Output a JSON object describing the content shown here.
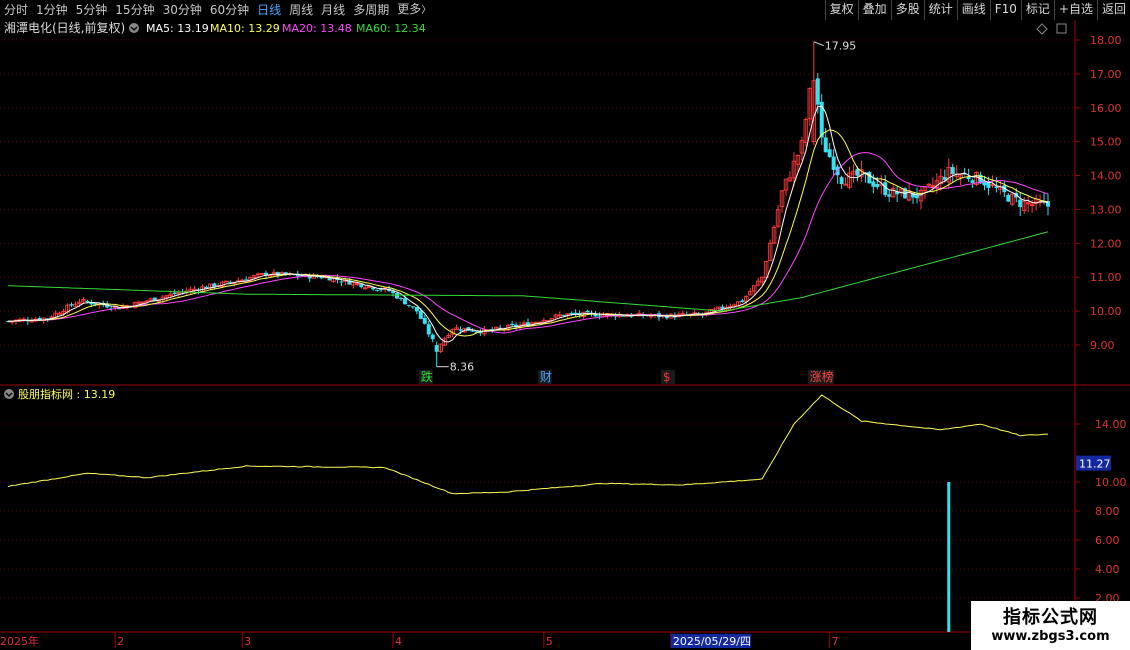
{
  "toolbar": {
    "left": [
      {
        "label": "分时",
        "active": false
      },
      {
        "label": "1分钟",
        "active": false
      },
      {
        "label": "5分钟",
        "active": false
      },
      {
        "label": "15分钟",
        "active": false
      },
      {
        "label": "30分钟",
        "active": false
      },
      {
        "label": "60分钟",
        "active": false
      },
      {
        "label": "日线",
        "active": true
      },
      {
        "label": "周线",
        "active": false
      },
      {
        "label": "月线",
        "active": false
      },
      {
        "label": "多周期",
        "active": false
      },
      {
        "label": "更多",
        "active": false
      }
    ],
    "more_arrow": "〉",
    "right": [
      "复权",
      "叠加",
      "多股",
      "统计",
      "画线",
      "F10",
      "标记",
      "+自选",
      "返回"
    ]
  },
  "main_panel": {
    "stock_title": "湘潭电化(日线,前复权)",
    "ma": [
      {
        "label": "MA5: 13.19",
        "color": "#ffffff"
      },
      {
        "label": "MA10: 13.29",
        "color": "#ffff55"
      },
      {
        "label": "MA20: 13.48",
        "color": "#ff44ff"
      },
      {
        "label": "MA60: 12.34",
        "color": "#33dd33"
      }
    ],
    "price_ticks": [
      "18.00",
      "17.00",
      "16.00",
      "15.00",
      "14.00",
      "13.00",
      "12.00",
      "11.00",
      "10.00",
      "9.00"
    ],
    "high_marker": "17.95",
    "low_marker": "8.36",
    "event_tags": [
      {
        "text": "跌",
        "color": "#33dd33",
        "day": 105
      },
      {
        "text": "财",
        "color": "#4da6ff",
        "day": 135
      },
      {
        "text": "$",
        "color": "#ff3333",
        "day": 166
      },
      {
        "text": "涨榜",
        "color": "#ff4444",
        "day": 203
      }
    ]
  },
  "sub_panel": {
    "title": "股朋指标网 : 13.19",
    "ticks": [
      "14.00",
      "10.00",
      "8.00",
      "6.00",
      "4.00",
      "2.00"
    ],
    "current_value": "11.27"
  },
  "time_axis": {
    "labels": [
      {
        "text": "2025年",
        "day": 0
      },
      {
        "text": "2",
        "day": 28
      },
      {
        "text": "3",
        "day": 60
      },
      {
        "text": "4",
        "day": 98
      },
      {
        "text": "5",
        "day": 136
      },
      {
        "text": "2025/05/29/四",
        "day": 168
      },
      {
        "text": "7",
        "day": 208
      }
    ],
    "highlight": "2025/05/29/四"
  },
  "watermark": {
    "title": "指标公式网",
    "url": "www.zbgs3.com"
  },
  "chart_data": {
    "type": "candlestick",
    "price_range": [
      8.2,
      18.3
    ],
    "indicator_range": [
      0,
      16.5
    ],
    "price_anchors": [
      [
        0,
        9.7
      ],
      [
        10,
        9.8
      ],
      [
        18,
        10.3
      ],
      [
        28,
        10.1
      ],
      [
        45,
        10.6
      ],
      [
        58,
        10.9
      ],
      [
        65,
        11.1
      ],
      [
        80,
        11.0
      ],
      [
        88,
        10.8
      ],
      [
        96,
        10.6
      ],
      [
        103,
        10.0
      ],
      [
        108,
        8.9
      ],
      [
        112,
        9.5
      ],
      [
        120,
        9.4
      ],
      [
        130,
        9.6
      ],
      [
        140,
        9.9
      ],
      [
        150,
        9.9
      ],
      [
        165,
        9.85
      ],
      [
        175,
        9.9
      ],
      [
        185,
        10.3
      ],
      [
        190,
        11.0
      ],
      [
        195,
        13.5
      ],
      [
        200,
        14.9
      ],
      [
        203,
        17.2
      ],
      [
        205,
        15.0
      ],
      [
        210,
        13.9
      ],
      [
        215,
        14.0
      ],
      [
        222,
        13.5
      ],
      [
        230,
        13.4
      ],
      [
        237,
        14.1
      ],
      [
        245,
        13.9
      ],
      [
        250,
        13.5
      ],
      [
        255,
        13.2
      ],
      [
        262,
        13.1
      ]
    ],
    "high_day": 203,
    "low_day": 108,
    "indicator_anchors": [
      [
        0,
        9.7
      ],
      [
        20,
        10.6
      ],
      [
        35,
        10.3
      ],
      [
        60,
        11.1
      ],
      [
        95,
        11.0
      ],
      [
        112,
        9.2
      ],
      [
        125,
        9.3
      ],
      [
        150,
        9.9
      ],
      [
        170,
        9.8
      ],
      [
        190,
        10.2
      ],
      [
        198,
        14.0
      ],
      [
        205,
        16.0
      ],
      [
        215,
        14.2
      ],
      [
        235,
        13.6
      ],
      [
        245,
        14.0
      ],
      [
        255,
        13.2
      ],
      [
        262,
        13.3
      ]
    ],
    "indicator_bar": {
      "day": 237,
      "value": 10.0
    },
    "ma60_anchors": [
      [
        0,
        10.75
      ],
      [
        60,
        10.5
      ],
      [
        130,
        10.45
      ],
      [
        180,
        10.0
      ],
      [
        200,
        10.4
      ],
      [
        262,
        12.34
      ]
    ]
  }
}
